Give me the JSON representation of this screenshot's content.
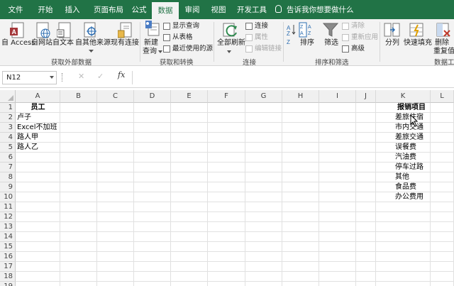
{
  "tabs": [
    "文件",
    "开始",
    "插入",
    "页面布局",
    "公式",
    "数据",
    "审阅",
    "视图",
    "开发工具"
  ],
  "active_tab": "数据",
  "tell_me": "告诉我你想要做什么",
  "ribbon": {
    "get_external": {
      "from_access": "自 Access",
      "from_web": "自网站",
      "from_text": "自文本",
      "from_other": "自其他来源",
      "existing": "现有连接",
      "group": "获取外部数据"
    },
    "transform": {
      "new_query_1": "新建",
      "new_query_2": "查询",
      "show_queries": "显示查询",
      "from_table": "从表格",
      "recent_sources": "最近使用的源",
      "group": "获取和转换"
    },
    "connections": {
      "refresh_all": "全部刷新",
      "connections": "连接",
      "properties": "属性",
      "edit_links": "编辑链接",
      "group": "连接"
    },
    "sort_filter": {
      "sort": "排序",
      "filter": "筛选",
      "clear": "清除",
      "reapply": "重新应用",
      "advanced": "高级",
      "group": "排序和筛选"
    },
    "data_tools": {
      "text_to_columns": "分列",
      "flash_fill": "快速填充",
      "remove_dup_1": "删除",
      "remove_dup_2": "重复值",
      "group": "数据工"
    }
  },
  "formula_bar": {
    "name_box": "N12",
    "cancel": "✕",
    "enter": "✓",
    "fx": "fx",
    "content": ""
  },
  "columns": [
    "A",
    "B",
    "C",
    "D",
    "E",
    "F",
    "G",
    "H",
    "I",
    "J",
    "K",
    "L"
  ],
  "rows": [
    "1",
    "2",
    "3",
    "4",
    "5",
    "6",
    "7",
    "8",
    "9",
    "10",
    "11",
    "12",
    "13",
    "14",
    "15",
    "16",
    "17",
    "18",
    "19"
  ],
  "col_a": {
    "header": "员工",
    "values": [
      "卢子",
      "Excel不加班",
      "路人甲",
      "路人乙"
    ]
  },
  "col_k": {
    "header": "报销项目",
    "values": [
      "差旅住宿",
      "市内交通",
      "差旅交通",
      "误餐费",
      "汽油费",
      "停车过路",
      "其他",
      "食品费",
      "办公费用"
    ]
  },
  "colors": {
    "accent": "#217346",
    "ribbon_bg": "#f3f3f3",
    "header_bg": "#f0f0f0",
    "gridline": "#e1e1e1"
  }
}
